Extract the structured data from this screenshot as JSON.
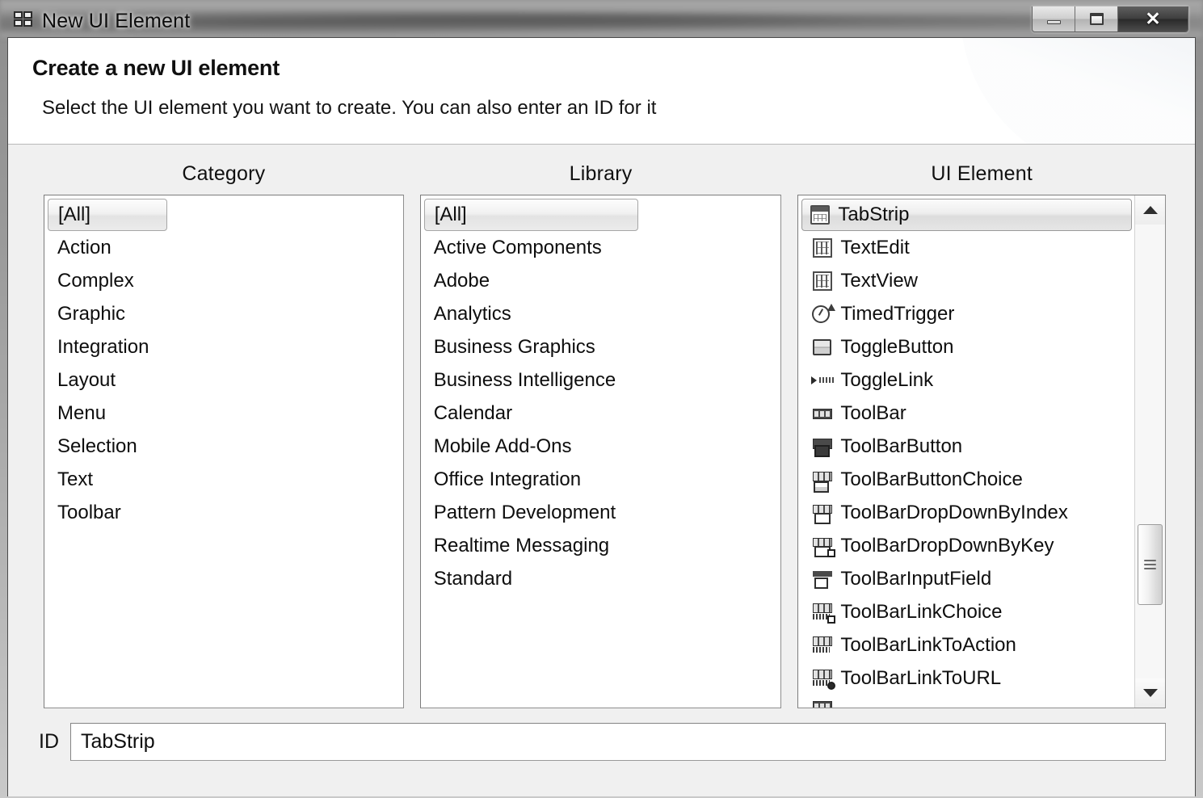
{
  "window": {
    "title": "New UI Element",
    "icon": "app-blocks-icon",
    "controls": {
      "minimize": "minimize-icon",
      "maximize": "maximize-icon",
      "close": "close-icon",
      "close_glyph": "✕"
    }
  },
  "header": {
    "title": "Create a new UI element",
    "subtitle": "Select the UI element you want to create. You can also enter an ID for it"
  },
  "columns": {
    "category": {
      "header": "Category",
      "items": [
        {
          "label": "[All]",
          "selected": true
        },
        {
          "label": "Action",
          "selected": false
        },
        {
          "label": "Complex",
          "selected": false
        },
        {
          "label": "Graphic",
          "selected": false
        },
        {
          "label": "Integration",
          "selected": false
        },
        {
          "label": "Layout",
          "selected": false
        },
        {
          "label": "Menu",
          "selected": false
        },
        {
          "label": "Selection",
          "selected": false
        },
        {
          "label": "Text",
          "selected": false
        },
        {
          "label": "Toolbar",
          "selected": false
        }
      ]
    },
    "library": {
      "header": "Library",
      "items": [
        {
          "label": "[All]",
          "selected": true
        },
        {
          "label": "Active Components",
          "selected": false
        },
        {
          "label": "Adobe",
          "selected": false
        },
        {
          "label": "Analytics",
          "selected": false
        },
        {
          "label": "Business Graphics",
          "selected": false
        },
        {
          "label": "Business Intelligence",
          "selected": false
        },
        {
          "label": "Calendar",
          "selected": false
        },
        {
          "label": "Mobile Add-Ons",
          "selected": false
        },
        {
          "label": "Office Integration",
          "selected": false
        },
        {
          "label": "Pattern Development",
          "selected": false
        },
        {
          "label": "Realtime Messaging",
          "selected": false
        },
        {
          "label": "Standard",
          "selected": false
        }
      ]
    },
    "ui_element": {
      "header": "UI Element",
      "items": [
        {
          "label": "TabStrip",
          "icon": "tabstrip-icon",
          "selected": true
        },
        {
          "label": "TextEdit",
          "icon": "textedit-icon",
          "selected": false
        },
        {
          "label": "TextView",
          "icon": "textview-icon",
          "selected": false
        },
        {
          "label": "TimedTrigger",
          "icon": "timedtrigger-icon",
          "selected": false
        },
        {
          "label": "ToggleButton",
          "icon": "togglebutton-icon",
          "selected": false
        },
        {
          "label": "ToggleLink",
          "icon": "togglelink-icon",
          "selected": false
        },
        {
          "label": "ToolBar",
          "icon": "toolbar-icon",
          "selected": false
        },
        {
          "label": "ToolBarButton",
          "icon": "toolbarbutton-icon",
          "selected": false
        },
        {
          "label": "ToolBarButtonChoice",
          "icon": "toolbarbuttonchoice-icon",
          "selected": false
        },
        {
          "label": "ToolBarDropDownByIndex",
          "icon": "toolbardropdownbyindex-icon",
          "selected": false
        },
        {
          "label": "ToolBarDropDownByKey",
          "icon": "toolbardropdownbykey-icon",
          "selected": false
        },
        {
          "label": "ToolBarInputField",
          "icon": "toolbarinputfield-icon",
          "selected": false
        },
        {
          "label": "ToolBarLinkChoice",
          "icon": "toolbarlinkchoice-icon",
          "selected": false
        },
        {
          "label": "ToolBarLinkToAction",
          "icon": "toolbarlinktoaction-icon",
          "selected": false
        },
        {
          "label": "ToolBarLinkToURL",
          "icon": "toolbarlinktourl-icon",
          "selected": false
        }
      ],
      "scrollbar": {
        "up_arrow": "scroll-up-arrow-icon",
        "down_arrow": "scroll-down-arrow-icon",
        "thumb_position_percent": 66
      }
    }
  },
  "id_field": {
    "label": "ID",
    "value": "TabStrip"
  },
  "colors": {
    "dialog_background": "#f0f0f0",
    "header_background": "#ffffff",
    "list_background": "#ffffff",
    "text": "#101010",
    "border": "#8e8e8e"
  }
}
